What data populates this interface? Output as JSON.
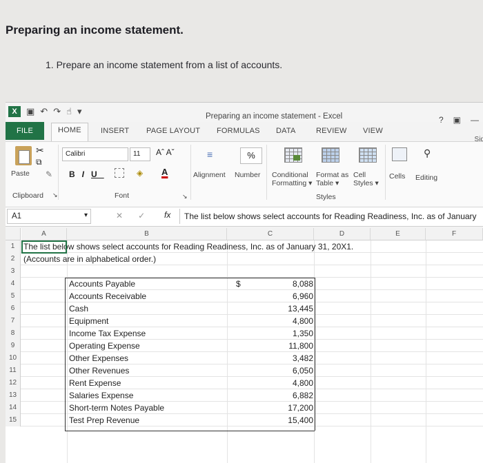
{
  "page": {
    "title": "Preparing an income statement.",
    "instruction": "1. Prepare an income statement from a list of accounts."
  },
  "window": {
    "title": "Preparing an income statement - Excel",
    "help": "?",
    "signin": "Sig"
  },
  "tabs": [
    "FILE",
    "HOME",
    "INSERT",
    "PAGE LAYOUT",
    "FORMULAS",
    "DATA",
    "REVIEW",
    "VIEW"
  ],
  "ribbon": {
    "paste": "Paste",
    "clipboard": "Clipboard",
    "font_name": "Calibri",
    "font_size": "11",
    "font_group": "Font",
    "bold": "B",
    "italic": "I",
    "underline": "U",
    "alignment": "Alignment",
    "number": "Number",
    "percent": "%",
    "conditional_1": "Conditional",
    "conditional_2": "Formatting",
    "format_as_1": "Format as",
    "format_as_2": "Table",
    "cell_styles_1": "Cell",
    "cell_styles_2": "Styles",
    "styles_group": "Styles",
    "cells": "Cells",
    "editing": "Editing"
  },
  "formula_bar": {
    "name_box": "A1",
    "fx": "fx",
    "content": "The list below shows select accounts for Reading Readiness, Inc. as of January"
  },
  "columns": [
    "A",
    "B",
    "C",
    "D",
    "E",
    "F"
  ],
  "rows": [
    "1",
    "2",
    "3",
    "4",
    "5",
    "6",
    "7",
    "8",
    "9",
    "10",
    "11",
    "12",
    "13",
    "14",
    "15"
  ],
  "sheet": {
    "row1": "The list below shows select accounts for Reading Readiness, Inc. as of January 31, 20X1.",
    "row2": "(Accounts are in alphabetical order.)",
    "currency_symbol": "$",
    "accounts": [
      {
        "name": "Accounts Payable",
        "amount": "8,088"
      },
      {
        "name": "Accounts Receivable",
        "amount": "6,960"
      },
      {
        "name": "Cash",
        "amount": "13,445"
      },
      {
        "name": "Equipment",
        "amount": "4,800"
      },
      {
        "name": "Income Tax Expense",
        "amount": "1,350"
      },
      {
        "name": "Operating Expense",
        "amount": "11,800"
      },
      {
        "name": "Other Expenses",
        "amount": "3,482"
      },
      {
        "name": "Other Revenues",
        "amount": "6,050"
      },
      {
        "name": "Rent Expense",
        "amount": "4,800"
      },
      {
        "name": "Salaries Expense",
        "amount": "6,882"
      },
      {
        "name": "Short-term Notes Payable",
        "amount": "17,200"
      },
      {
        "name": "Test Prep Revenue",
        "amount": "15,400"
      }
    ]
  }
}
